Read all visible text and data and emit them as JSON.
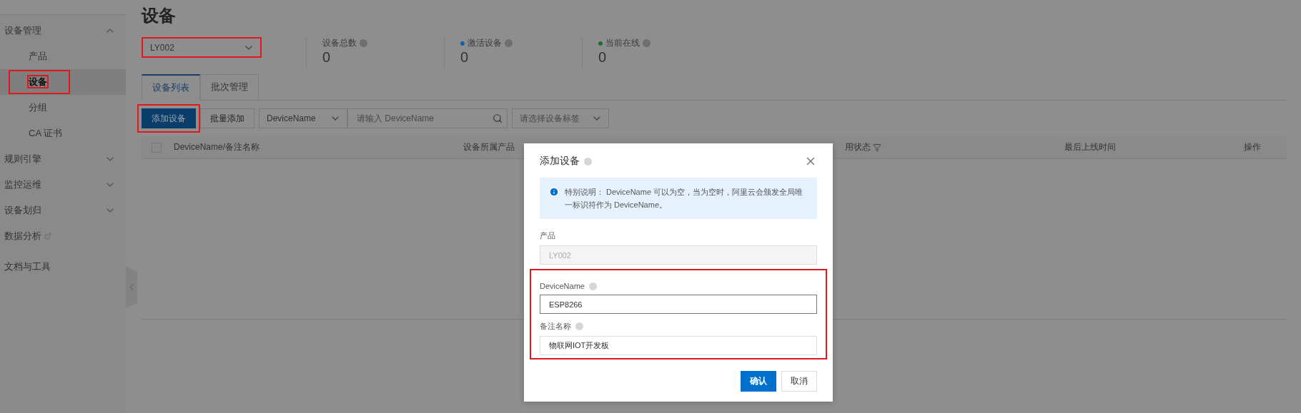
{
  "sidebar": {
    "items": [
      {
        "label": "设备管理",
        "kind": "group",
        "expanded": true,
        "children": [
          {
            "label": "产品",
            "selected": false
          },
          {
            "label": "设备",
            "selected": true
          },
          {
            "label": "分组",
            "selected": false
          },
          {
            "label": "CA 证书",
            "selected": false
          }
        ]
      },
      {
        "label": "规则引擎",
        "kind": "group",
        "expanded": false
      },
      {
        "label": "监控运维",
        "kind": "group",
        "expanded": false
      },
      {
        "label": "设备划归",
        "kind": "group",
        "expanded": false
      },
      {
        "label": "数据分析",
        "kind": "external"
      },
      {
        "label": "文档与工具",
        "kind": "link"
      }
    ]
  },
  "page": {
    "title": "设备",
    "product_select": {
      "value": "LY002"
    },
    "stats": [
      {
        "label": "设备总数",
        "value": "0"
      },
      {
        "label": "激活设备",
        "value": "0",
        "color": "#1a5fa8"
      },
      {
        "label": "当前在线",
        "value": "0",
        "color": "#1f6e2e"
      }
    ]
  },
  "tabs": [
    {
      "label": "设备列表",
      "selected": true
    },
    {
      "label": "批次管理",
      "selected": false
    }
  ],
  "toolbar": {
    "primary_button": "添加设备",
    "secondary_button": "批量添加",
    "field_select": "DeviceName",
    "search": {
      "placeholder": "请输入 DeviceName"
    },
    "tag_select": {
      "placeholder": "请选择设备标签"
    }
  },
  "table": {
    "columns": [
      "DeviceName/备注名称",
      "设备所属产品",
      "用状态",
      "最后上线时间",
      "操作"
    ]
  },
  "dialog": {
    "title": "添加设备",
    "notice": "特别说明： DeviceName 可以为空，当为空时，阿里云会颁发全局唯一标识符作为 DeviceName。",
    "fields": [
      {
        "label": "产品",
        "value": "LY002",
        "disabled": true,
        "help": false
      },
      {
        "label": "DeviceName",
        "value": "ESP8266",
        "disabled": false,
        "help": true,
        "focused": true
      },
      {
        "label": "备注名称",
        "value": "物联网IOT开发板",
        "disabled": false,
        "help": true,
        "focused": false
      }
    ],
    "buttons": [
      {
        "label": "确认",
        "primary": true
      },
      {
        "label": "取消",
        "primary": false
      }
    ]
  }
}
